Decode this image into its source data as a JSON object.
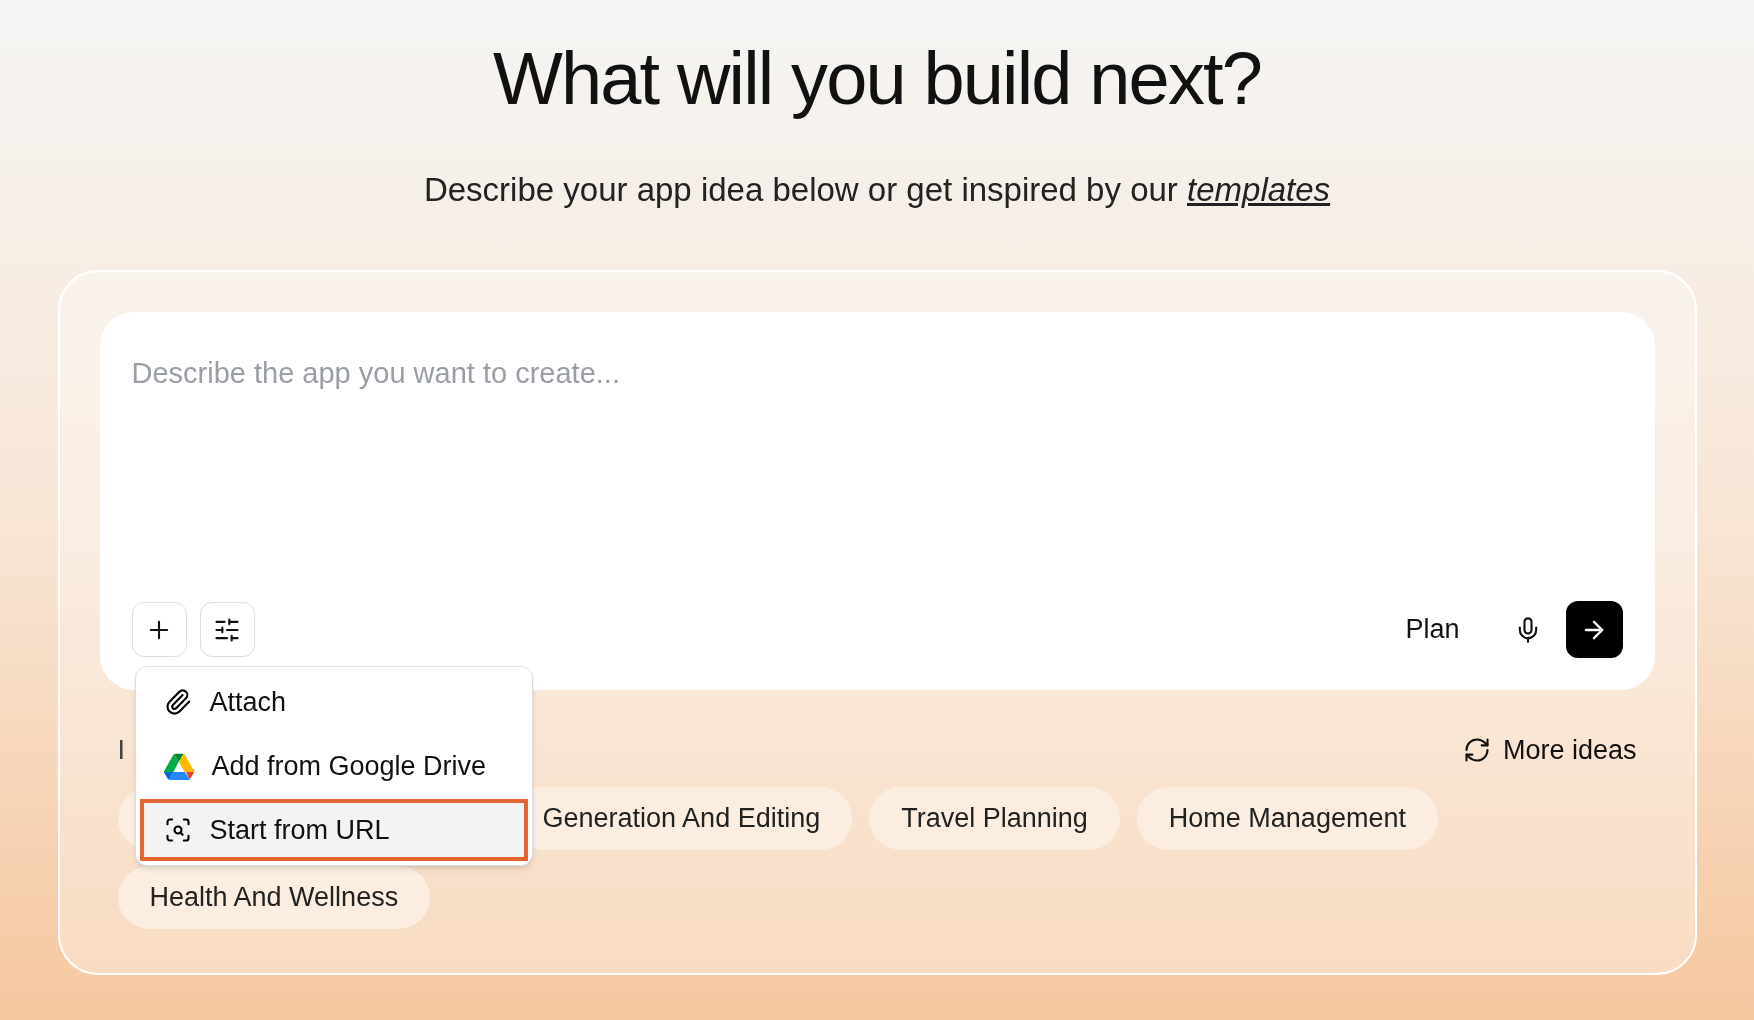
{
  "heading": "What will you build next?",
  "subtitle": {
    "text": "Describe your app idea below or get inspired by our",
    "link": "templates"
  },
  "prompt": {
    "placeholder": "Describe the app you want to create..."
  },
  "toolbar": {
    "plan": "Plan"
  },
  "menu": [
    {
      "label": "Attach",
      "kind": "attach",
      "selected": false
    },
    {
      "label": "Add from Google Drive",
      "kind": "drive",
      "selected": false
    },
    {
      "label": "Start from URL",
      "kind": "url",
      "selected": true
    }
  ],
  "ideas": {
    "label": "I",
    "more": "More ideas",
    "chips": [
      {
        "kind": "hidden"
      },
      {
        "label": "Generation And Editing"
      },
      {
        "label": "Travel Planning"
      },
      {
        "label": "Home Management"
      },
      {
        "label": "Health And Wellness"
      }
    ]
  }
}
